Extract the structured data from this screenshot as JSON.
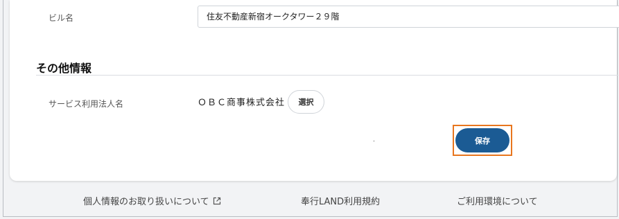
{
  "form": {
    "building_name_label": "ビル名",
    "building_name_value": "住友不動産新宿オークタワー２９階"
  },
  "other_info": {
    "section_title": "その他情報",
    "service_corp_label": "サービス利用法人名",
    "service_corp_value": "ＯＢＣ商事株式会社",
    "select_button": "選択"
  },
  "actions": {
    "save_button": "保存"
  },
  "footer": {
    "privacy_link": "個人情報のお取り扱いについて",
    "terms_link": "奉行LAND利用規約",
    "environment_link": "ご利用環境について"
  },
  "colors": {
    "primary": "#1b5b94",
    "highlight": "#e8761e"
  },
  "icons": {
    "privacy_link_icon": "external-link-icon"
  }
}
